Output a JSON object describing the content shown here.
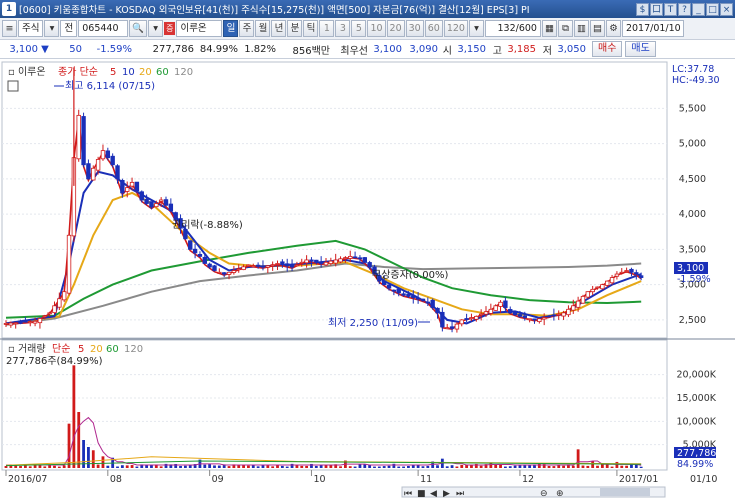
{
  "window": {
    "number": "1",
    "title": "[0600] 키움종합차트 - KOSDAQ 외국인보유[41(천)] 주식수[15,275(천)] 액면[500] 자본금[76(억)] 결산[12월] EPS[3] PI",
    "controls": [
      "$",
      "口",
      "T",
      "?",
      "_",
      "□",
      "×"
    ]
  },
  "toolbar": {
    "type_label": "주식",
    "period_label": "전",
    "code": "065440",
    "stock_badge": "증",
    "stock_name": "이루온",
    "period_buttons": [
      "일",
      "주",
      "월",
      "년",
      "분",
      "틱"
    ],
    "minute_buttons": [
      "1",
      "3",
      "5",
      "10",
      "20",
      "30",
      "60",
      "120"
    ],
    "count": "132",
    "count_max": "/600",
    "date": "2017/01/10"
  },
  "quote": {
    "price": "3,100",
    "arrow": "▼",
    "change": "50",
    "change_pct": "-1.59%",
    "volume": "277,786",
    "vol_ratio": "84.99%",
    "turnover": "1.82%",
    "amount": "856백만",
    "best_label": "최우선",
    "ask": "3,100",
    "bid": "3,090",
    "open_label": "시",
    "open": "3,150",
    "high_label": "고",
    "high": "3,185",
    "low_label": "저",
    "low": "3,050",
    "buy_label": "매수",
    "sell_label": "매도"
  },
  "chart": {
    "name": "이루온",
    "ma_label": "종가 단순",
    "ma_periods": [
      "5",
      "10",
      "20",
      "60",
      "120"
    ],
    "ma_colors": [
      "#d11a1a",
      "#1a2fb8",
      "#e6a817",
      "#1f9a34",
      "#8a8a8a"
    ],
    "lc": "LC:37.78",
    "hc": "HC:-49.30",
    "high_annotation": "최고 6,114 (07/15)",
    "low_annotation": "최저 2,250 (11/09)",
    "annotation_1": "권리락(-8.88%)",
    "annotation_2": "무상증자(0.00%)",
    "price_tag": "3,100",
    "price_tag_pct": "-1.59%",
    "y_ticks": [
      "5,500",
      "5,000",
      "4,500",
      "4,000",
      "3,500",
      "3,000",
      "2,500"
    ],
    "volume_label": "거래량",
    "volume_ma_label": "단순",
    "volume_ma_periods": [
      "5",
      "20",
      "60",
      "120"
    ],
    "volume_ma_colors": [
      "#d11a1a",
      "#e6a817",
      "#1f9a34",
      "#8a8a8a"
    ],
    "volume_value": "277,786주(84.99%)",
    "vol_ticks": [
      "20,000K",
      "15,000K",
      "10,000K",
      "5,000K"
    ],
    "vol_tag": "277,786",
    "vol_tag_pct": "84.99%",
    "x_ticks": [
      "2016/07",
      "08",
      "09",
      "10",
      "11",
      "12",
      "2017/01",
      "01/10"
    ]
  },
  "chart_data": {
    "type": "candlestick",
    "price_axis": {
      "min": 2300,
      "max": 6100,
      "ticks": [
        5500,
        5000,
        4500,
        4000,
        3500,
        3000,
        2500
      ]
    },
    "volume_axis": {
      "min": 0,
      "max": 24000,
      "ticks": [
        20000,
        15000,
        10000,
        5000
      ],
      "unit": "K"
    },
    "close_path": [
      [
        0,
        2450
      ],
      [
        6,
        2480
      ],
      [
        9,
        2600
      ],
      [
        12,
        2900
      ],
      [
        13,
        3700
      ],
      [
        14,
        4800
      ],
      [
        15,
        5400
      ],
      [
        16,
        4700
      ],
      [
        17,
        4500
      ],
      [
        18,
        4650
      ],
      [
        20,
        4900
      ],
      [
        22,
        4700
      ],
      [
        24,
        4300
      ],
      [
        26,
        4450
      ],
      [
        28,
        4200
      ],
      [
        30,
        4100
      ],
      [
        32,
        4200
      ],
      [
        34,
        4050
      ],
      [
        36,
        3800
      ],
      [
        38,
        3500
      ],
      [
        40,
        3400
      ],
      [
        41,
        3300
      ],
      [
        43,
        3200
      ],
      [
        45,
        3150
      ],
      [
        47,
        3200
      ],
      [
        50,
        3280
      ],
      [
        53,
        3250
      ],
      [
        56,
        3300
      ],
      [
        59,
        3250
      ],
      [
        62,
        3350
      ],
      [
        65,
        3300
      ],
      [
        68,
        3350
      ],
      [
        71,
        3400
      ],
      [
        73,
        3380
      ],
      [
        75,
        3250
      ],
      [
        77,
        3050
      ],
      [
        79,
        2950
      ],
      [
        82,
        2850
      ],
      [
        85,
        2800
      ],
      [
        87,
        2750
      ],
      [
        89,
        2600
      ],
      [
        90,
        2400
      ],
      [
        92,
        2380
      ],
      [
        94,
        2500
      ],
      [
        97,
        2550
      ],
      [
        100,
        2650
      ],
      [
        102,
        2750
      ],
      [
        104,
        2600
      ],
      [
        106,
        2550
      ],
      [
        109,
        2500
      ],
      [
        112,
        2550
      ],
      [
        115,
        2600
      ],
      [
        117,
        2700
      ],
      [
        120,
        2900
      ],
      [
        123,
        3000
      ],
      [
        126,
        3150
      ],
      [
        128,
        3200
      ],
      [
        130,
        3150
      ],
      [
        131,
        3100
      ]
    ],
    "ma_paths": {
      "ma10": [
        [
          0,
          2450
        ],
        [
          10,
          2550
        ],
        [
          13,
          3300
        ],
        [
          16,
          4300
        ],
        [
          19,
          4600
        ],
        [
          22,
          4550
        ],
        [
          26,
          4350
        ],
        [
          30,
          4200
        ],
        [
          34,
          4050
        ],
        [
          38,
          3700
        ],
        [
          42,
          3350
        ],
        [
          46,
          3200
        ],
        [
          50,
          3250
        ],
        [
          56,
          3270
        ],
        [
          62,
          3300
        ],
        [
          70,
          3350
        ],
        [
          74,
          3300
        ],
        [
          78,
          3050
        ],
        [
          84,
          2850
        ],
        [
          88,
          2700
        ],
        [
          91,
          2500
        ],
        [
          95,
          2450
        ],
        [
          100,
          2600
        ],
        [
          105,
          2620
        ],
        [
          110,
          2530
        ],
        [
          115,
          2580
        ],
        [
          120,
          2800
        ],
        [
          125,
          3000
        ],
        [
          131,
          3150
        ]
      ],
      "ma20": [
        [
          0,
          2450
        ],
        [
          11,
          2550
        ],
        [
          14,
          3000
        ],
        [
          18,
          3700
        ],
        [
          22,
          4200
        ],
        [
          26,
          4300
        ],
        [
          30,
          4150
        ],
        [
          34,
          3900
        ],
        [
          38,
          3650
        ],
        [
          42,
          3450
        ],
        [
          46,
          3300
        ],
        [
          52,
          3260
        ],
        [
          60,
          3270
        ],
        [
          70,
          3320
        ],
        [
          76,
          3150
        ],
        [
          82,
          2950
        ],
        [
          88,
          2800
        ],
        [
          94,
          2650
        ],
        [
          100,
          2580
        ],
        [
          106,
          2580
        ],
        [
          112,
          2560
        ],
        [
          118,
          2650
        ],
        [
          124,
          2850
        ],
        [
          131,
          3050
        ]
      ],
      "ma60": [
        [
          0,
          2530
        ],
        [
          10,
          2560
        ],
        [
          16,
          2800
        ],
        [
          22,
          3000
        ],
        [
          30,
          3200
        ],
        [
          40,
          3330
        ],
        [
          50,
          3450
        ],
        [
          60,
          3550
        ],
        [
          68,
          3620
        ],
        [
          74,
          3500
        ],
        [
          80,
          3300
        ],
        [
          86,
          3100
        ],
        [
          92,
          2950
        ],
        [
          100,
          2850
        ],
        [
          108,
          2780
        ],
        [
          116,
          2750
        ],
        [
          124,
          2740
        ],
        [
          131,
          2760
        ]
      ],
      "ma120": [
        [
          0,
          2430
        ],
        [
          10,
          2520
        ],
        [
          20,
          2700
        ],
        [
          30,
          2900
        ],
        [
          40,
          3050
        ],
        [
          50,
          3130
        ],
        [
          60,
          3200
        ],
        [
          70,
          3300
        ],
        [
          78,
          3250
        ],
        [
          86,
          3220
        ],
        [
          96,
          3230
        ],
        [
          106,
          3240
        ],
        [
          116,
          3250
        ],
        [
          124,
          3270
        ],
        [
          131,
          3300
        ]
      ]
    },
    "volume_spikes": [
      [
        13,
        9500
      ],
      [
        14,
        22000
      ],
      [
        15,
        12000
      ],
      [
        16,
        6000
      ],
      [
        17,
        4500
      ],
      [
        18,
        3800
      ],
      [
        20,
        2500
      ],
      [
        22,
        2200
      ],
      [
        40,
        1800
      ],
      [
        70,
        1600
      ],
      [
        88,
        1400
      ],
      [
        90,
        2000
      ],
      [
        100,
        1200
      ],
      [
        118,
        4000
      ],
      [
        121,
        1500
      ],
      [
        126,
        1300
      ],
      [
        131,
        278
      ]
    ]
  }
}
